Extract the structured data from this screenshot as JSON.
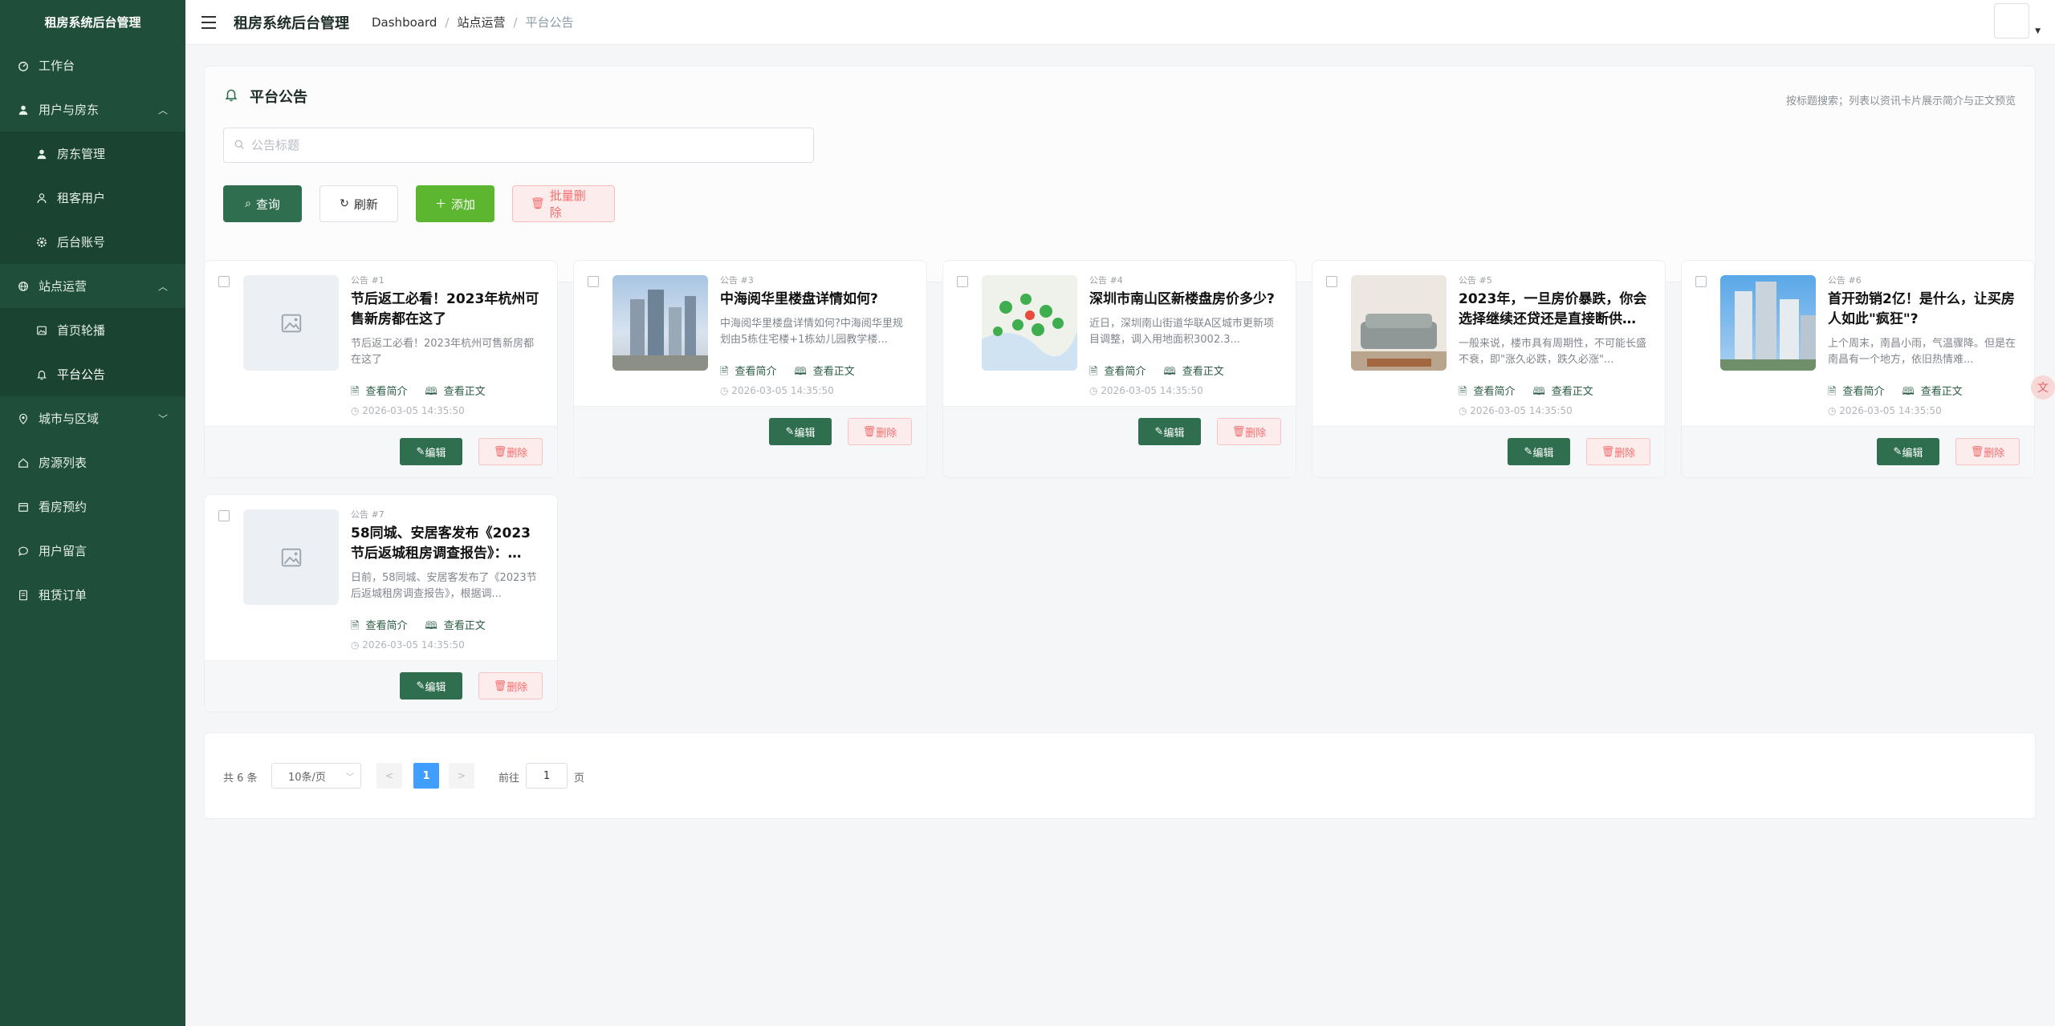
{
  "sidebar": {
    "title": "租房系统后台管理",
    "items": [
      {
        "label": "工作台"
      },
      {
        "label": "用户与房东"
      },
      {
        "label": "房东管理"
      },
      {
        "label": "租客用户"
      },
      {
        "label": "后台账号"
      },
      {
        "label": "站点运营"
      },
      {
        "label": "首页轮播"
      },
      {
        "label": "平台公告"
      },
      {
        "label": "城市与区域"
      },
      {
        "label": "房源列表"
      },
      {
        "label": "看房预约"
      },
      {
        "label": "用户留言"
      },
      {
        "label": "租赁订单"
      }
    ]
  },
  "header": {
    "title": "租房系统后台管理",
    "breadcrumb": [
      "Dashboard",
      "站点运营",
      "平台公告"
    ],
    "sep": "/"
  },
  "panel": {
    "title": "平台公告",
    "hint": "按标题搜索；列表以资讯卡片展示简介与正文预览",
    "search_placeholder": "公告标题",
    "buttons": {
      "query": "查询",
      "refresh": "刷新",
      "add": "添加",
      "batch_delete": "批量删除"
    }
  },
  "card_labels": {
    "view_intro": "查看简介",
    "view_body": "查看正文",
    "edit": "编辑",
    "delete": "删除"
  },
  "cards": [
    {
      "meta": "公告 #1",
      "title": "节后返工必看！2023年杭州可售新房都在这了",
      "excerpt": "节后返工必看！2023年杭州可售新房都在这了",
      "time": "2026-03-05 14:35:50"
    },
    {
      "meta": "公告 #3",
      "title": "中海阅华里楼盘详情如何?",
      "excerpt": "中海阅华里楼盘详情如何?中海阅华里规划由5栋住宅楼+1栋幼儿园教学楼...",
      "time": "2026-03-05 14:35:50"
    },
    {
      "meta": "公告 #4",
      "title": "深圳市南山区新楼盘房价多少?",
      "excerpt": "近日，深圳南山街道华联A区城市更新项目调整，调入用地面积3002.3...",
      "time": "2026-03-05 14:35:50"
    },
    {
      "meta": "公告 #5",
      "title": "2023年，一旦房价暴跌，你会选择继续还贷还是直接断供…",
      "excerpt": "一般来说，楼市具有周期性，不可能长盛不衰，即\"涨久必跌，跌久必涨\"...",
      "time": "2026-03-05 14:35:50"
    },
    {
      "meta": "公告 #6",
      "title": "首开劲销2亿！是什么，让买房人如此\"疯狂\"?",
      "excerpt": "上个周末，南昌小雨，气温骤降。但是在南昌有一个地方，依旧热情难...",
      "time": "2026-03-05 14:35:50"
    },
    {
      "meta": "公告 #7",
      "title": "58同城、安居客发布《2023节后返城租房调查报告》：…",
      "excerpt": "日前，58同城、安居客发布了《2023节后返城租房调查报告》，根据调...",
      "time": "2026-03-05 14:35:50"
    }
  ],
  "pager": {
    "total": "共 6 条",
    "size": "10条/页",
    "current": "1",
    "goto": "前往",
    "goto_value": "1",
    "page": "页"
  },
  "colors": {
    "sidebar": "#1f4e3a",
    "primary": "#2f6f4f",
    "add": "#5cb630",
    "danger": "#f56c6c",
    "page_active": "#409eff"
  }
}
